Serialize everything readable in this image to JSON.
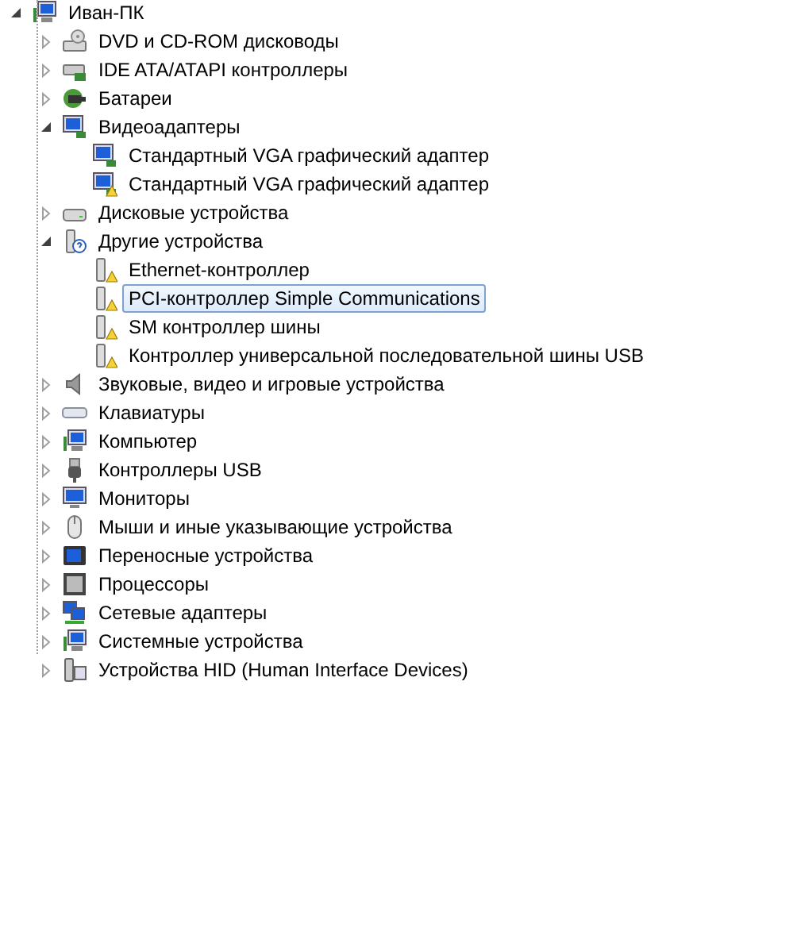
{
  "tree": {
    "label": "Иван-ПК",
    "kind": "computer",
    "expanded": true,
    "children": [
      {
        "label": "DVD и CD-ROM дисководы",
        "kind": "dvd",
        "expanded": false,
        "selected": false
      },
      {
        "label": "IDE ATA/ATAPI контроллеры",
        "kind": "ide",
        "expanded": false,
        "selected": false
      },
      {
        "label": "Батареи",
        "kind": "battery",
        "expanded": false,
        "selected": false
      },
      {
        "label": "Видеоадаптеры",
        "kind": "display",
        "expanded": true,
        "selected": false,
        "children": [
          {
            "label": "Стандартный VGA графический адаптер",
            "kind": "display",
            "warning": false,
            "selected": false
          },
          {
            "label": "Стандартный VGA графический адаптер",
            "kind": "display",
            "warning": true,
            "selected": false
          }
        ]
      },
      {
        "label": "Дисковые устройства",
        "kind": "disk",
        "expanded": false,
        "selected": false
      },
      {
        "label": "Другие устройства",
        "kind": "unknown",
        "expanded": true,
        "selected": false,
        "children": [
          {
            "label": "Ethernet-контроллер",
            "kind": "other",
            "warning": true,
            "selected": false
          },
          {
            "label": "PCI-контроллер Simple Communications",
            "kind": "other",
            "warning": true,
            "selected": true
          },
          {
            "label": "SM контроллер шины",
            "kind": "other",
            "warning": true,
            "selected": false
          },
          {
            "label": "Контроллер универсальной последовательной шины USB",
            "kind": "other",
            "warning": true,
            "selected": false
          }
        ]
      },
      {
        "label": "Звуковые, видео и игровые устройства",
        "kind": "sound",
        "expanded": false,
        "selected": false
      },
      {
        "label": "Клавиатуры",
        "kind": "keyboard",
        "expanded": false,
        "selected": false
      },
      {
        "label": "Компьютер",
        "kind": "computer",
        "expanded": false,
        "selected": false
      },
      {
        "label": "Контроллеры USB",
        "kind": "usb",
        "expanded": false,
        "selected": false
      },
      {
        "label": "Мониторы",
        "kind": "monitor",
        "expanded": false,
        "selected": false
      },
      {
        "label": "Мыши и иные указывающие устройства",
        "kind": "mouse",
        "expanded": false,
        "selected": false
      },
      {
        "label": "Переносные устройства",
        "kind": "portable",
        "expanded": false,
        "selected": false
      },
      {
        "label": "Процессоры",
        "kind": "cpu",
        "expanded": false,
        "selected": false
      },
      {
        "label": "Сетевые адаптеры",
        "kind": "network",
        "expanded": false,
        "selected": false
      },
      {
        "label": "Системные устройства",
        "kind": "computer",
        "expanded": false,
        "selected": false
      },
      {
        "label": "Устройства HID (Human Interface Devices)",
        "kind": "hid",
        "expanded": false,
        "selected": false
      }
    ]
  }
}
